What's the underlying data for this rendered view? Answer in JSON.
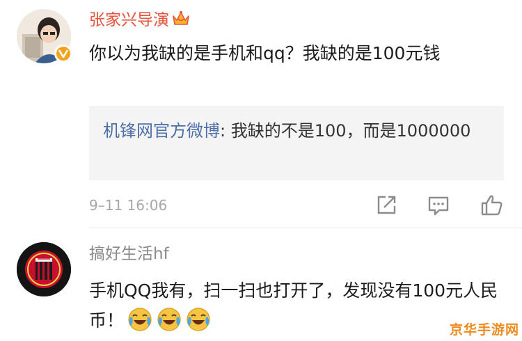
{
  "comments": [
    {
      "author": "张家兴导演",
      "text": "你以为我缺的是手机和qq？我缺的是100元钱",
      "quoted": {
        "author": "机锋网官方微博",
        "separator": ": ",
        "text": "我缺的不是100，而是1000000"
      },
      "timestamp": "9–11 16:06",
      "actions": [
        "share-icon",
        "comment-icon",
        "like-icon"
      ]
    },
    {
      "author": "搞好生活hf",
      "text": "手机QQ我有，扫一扫也打开了，发现没有100元人民币！",
      "emojis": [
        "laugh-cry-emoji",
        "laugh-cry-emoji",
        "laugh-cry-emoji"
      ]
    }
  ],
  "watermark": "京华手游网",
  "colors": {
    "author_highlight": "#e9523e",
    "author_muted": "#8a8a8a",
    "quote_author": "#4d6fa8",
    "verified_badge": "#f3a21e",
    "watermark": "#f08a1c"
  }
}
